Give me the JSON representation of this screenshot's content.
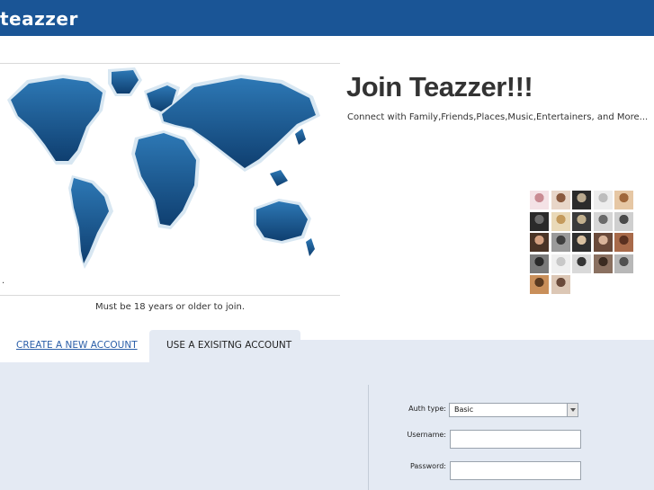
{
  "header": {
    "logo": "teazzer"
  },
  "hero": {
    "title": "Join Teazzer!!!",
    "tagline": "Connect with Family,Friends,Places,Music,Entertainers, and More...",
    "age_notice": "Must be 18 years or older to join.",
    "dot": "."
  },
  "tabs": [
    {
      "label": "CREATE A NEW ACCOUNT",
      "active": false
    },
    {
      "label": "USE A EXISITNG ACCOUNT",
      "active": true
    }
  ],
  "login_form": {
    "auth_type_label": "Auth type:",
    "auth_type_value": "Basic",
    "username_label": "Username:",
    "username_value": "",
    "password_label": "Password:",
    "password_value": ""
  },
  "avatar_grid": {
    "count": 22,
    "columns": 5
  },
  "colors": {
    "header_bg": "#1a5596",
    "tab_panel_bg": "#e4eaf3",
    "link": "#2a5ea8",
    "map_blue": "#1d5d94"
  }
}
